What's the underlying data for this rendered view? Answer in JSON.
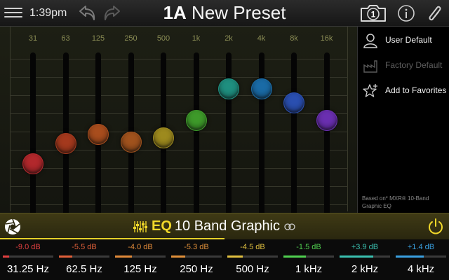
{
  "header": {
    "time": "1:39pm",
    "preset_slot": "1A",
    "preset_name": "New Preset",
    "snapshot_number": "1"
  },
  "eq": {
    "slider_range_db": [
      -12,
      12
    ],
    "bands": [
      {
        "label": "31",
        "db": -9.0,
        "color": "#b2282c"
      },
      {
        "label": "63",
        "db": -5.5,
        "color": "#a4391d"
      },
      {
        "label": "125",
        "db": -4.0,
        "color": "#a84d1d"
      },
      {
        "label": "250",
        "db": -5.3,
        "color": "#a0521d"
      },
      {
        "label": "500",
        "db": -4.5,
        "color": "#9d8a1e"
      },
      {
        "label": "1k",
        "db": -1.5,
        "color": "#3e9a2a"
      },
      {
        "label": "2k",
        "db": 3.9,
        "color": "#1f8f7f"
      },
      {
        "label": "4k",
        "db": 3.9,
        "color": "#1a6ba6"
      },
      {
        "label": "8k",
        "db": 1.4,
        "color": "#2a4fb0"
      },
      {
        "label": "16k",
        "db": -1.5,
        "color": "#6a2fb0"
      }
    ]
  },
  "side": {
    "user_default": "User Default",
    "factory_default": "Factory Default",
    "add_favorites": "Add to Favorites",
    "based_on": "Based on* MXR® 10-Band Graphic EQ"
  },
  "model": {
    "category": "EQ",
    "name": "10 Band Graphic"
  },
  "params": [
    {
      "value": "-9.0 dB",
      "name": "31.25 Hz",
      "color": "#e04040",
      "level": 0.125
    },
    {
      "value": "-5.5 dB",
      "name": "62.5 Hz",
      "color": "#e0603a",
      "level": 0.27
    },
    {
      "value": "-4.0 dB",
      "name": "125 Hz",
      "color": "#e08a3a",
      "level": 0.33
    },
    {
      "value": "-5.3 dB",
      "name": "250 Hz",
      "color": "#e0903a",
      "level": 0.28
    },
    {
      "value": "-4.5 dB",
      "name": "500 Hz",
      "color": "#e0c040",
      "level": 0.31
    },
    {
      "value": "-1.5 dB",
      "name": "1 kHz",
      "color": "#50d050",
      "level": 0.44
    },
    {
      "value": "+3.9 dB",
      "name": "2 kHz",
      "color": "#3ac0b0",
      "level": 0.66
    },
    {
      "value": "+1.4 dB",
      "name": "4 kHz",
      "color": "#3aa0e0",
      "level": 0.56
    }
  ]
}
